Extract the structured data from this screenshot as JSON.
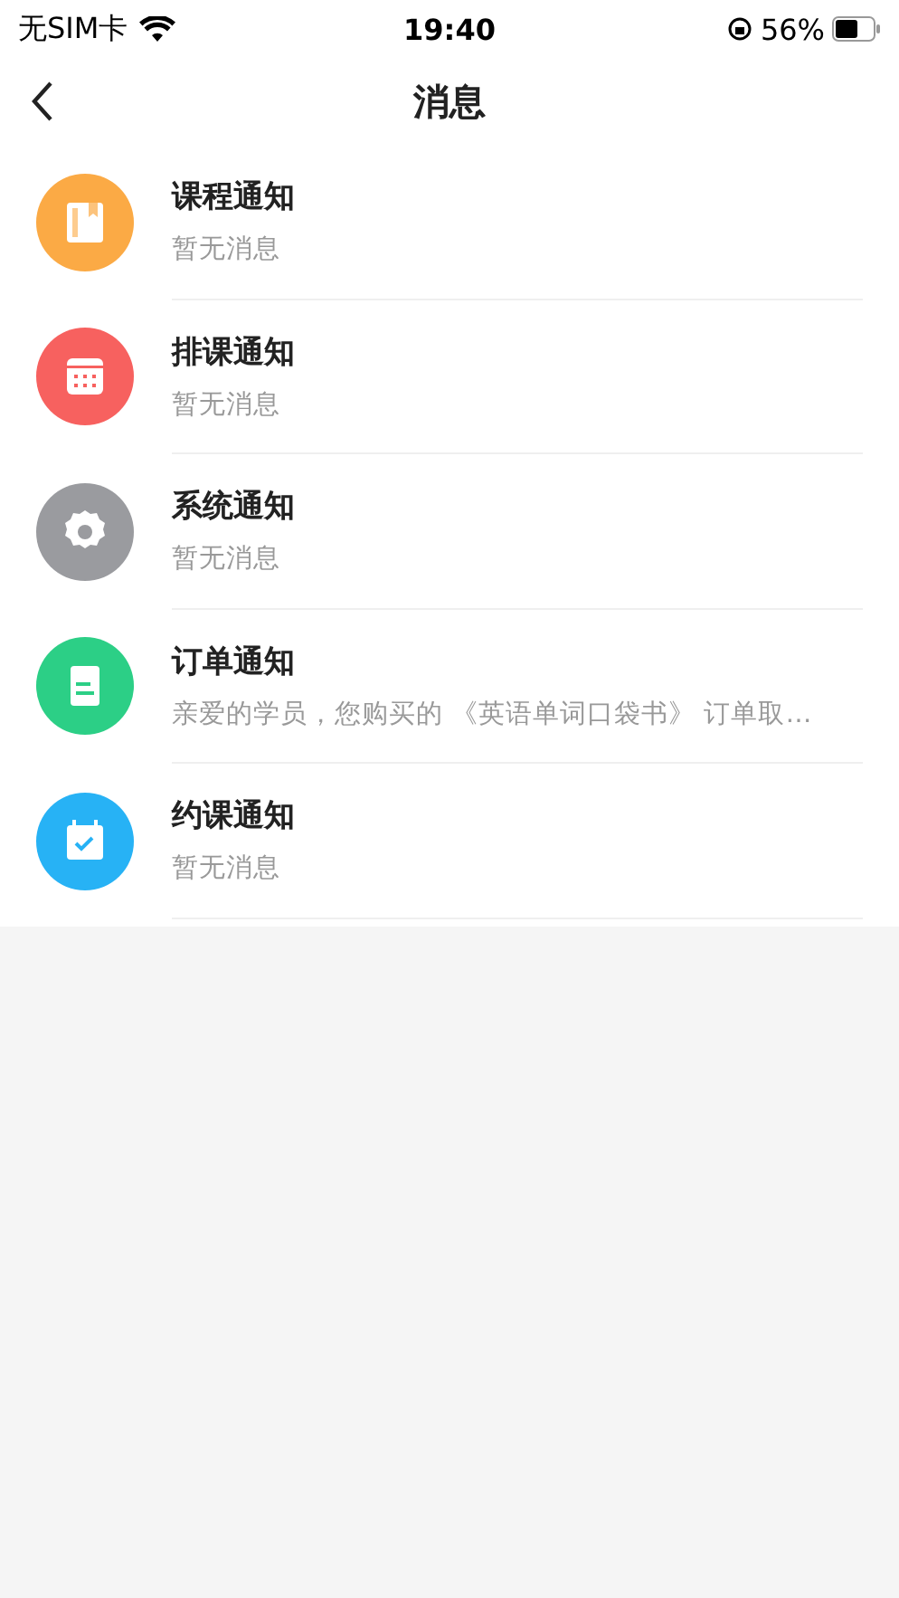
{
  "status_bar": {
    "carrier": "无SIM卡",
    "time": "19:40",
    "battery": "56%"
  },
  "nav": {
    "title": "消息"
  },
  "messages": [
    {
      "kind": "book",
      "color": "#fbaa45",
      "title": "课程通知",
      "preview": "暂无消息"
    },
    {
      "kind": "calendar",
      "color": "#f7615f",
      "title": "排课通知",
      "preview": "暂无消息"
    },
    {
      "kind": "gear",
      "color": "#9a9b9f",
      "title": "系统通知",
      "preview": "暂无消息"
    },
    {
      "kind": "clipboard",
      "color": "#2ccf86",
      "title": "订单通知",
      "preview": "亲爱的学员，您购买的 《英语单词口袋书》 订单取…"
    },
    {
      "kind": "check-calendar",
      "color": "#27b2f5",
      "title": "约课通知",
      "preview": "暂无消息"
    }
  ]
}
